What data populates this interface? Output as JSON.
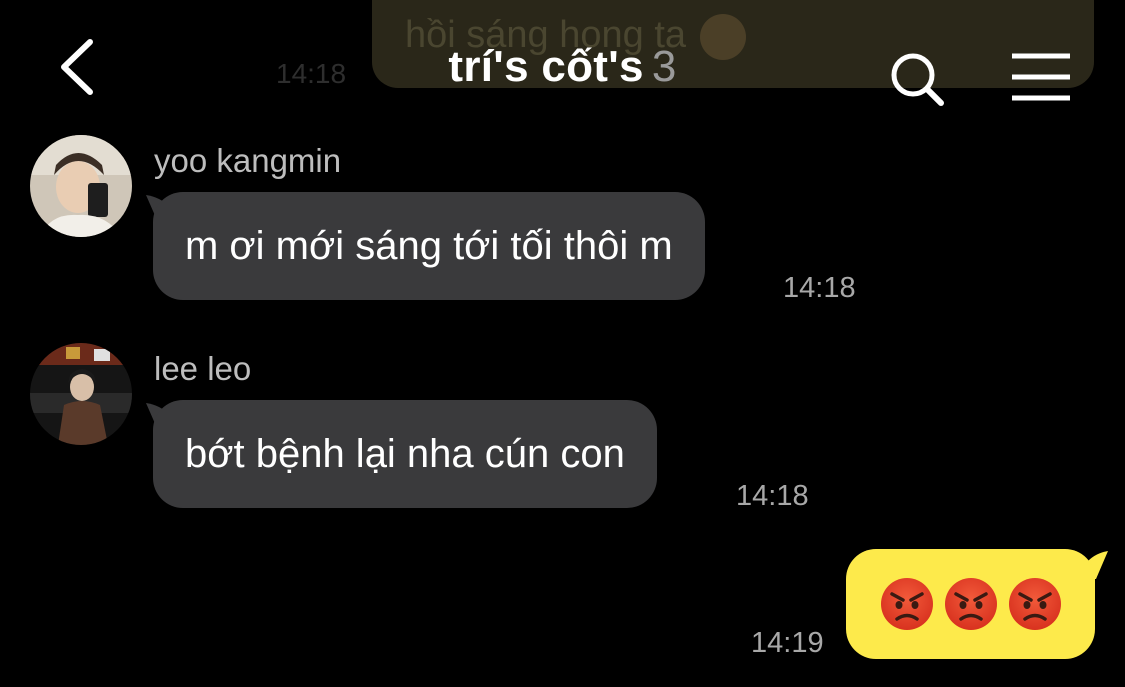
{
  "header": {
    "title": "trí's cốt's",
    "member_count": "3",
    "back_icon": "chevron-left-icon",
    "search_icon": "search-icon",
    "menu_icon": "hamburger-menu-icon"
  },
  "previous_message": {
    "text": "hồi sáng hong ta",
    "time": "14:18"
  },
  "messages": [
    {
      "sender": "yoo kangmin",
      "text": "m ơi mới sáng tới tối thôi m",
      "time": "14:18"
    },
    {
      "sender": "lee leo",
      "text": "bớt bệnh lại nha cún con",
      "time": "14:18"
    }
  ],
  "outgoing": {
    "emojis": [
      "😡",
      "😡",
      "😡"
    ],
    "time": "14:19"
  },
  "colors": {
    "background": "#000000",
    "incoming_bubble": "#3a3a3c",
    "outgoing_bubble": "#fdea4b"
  }
}
